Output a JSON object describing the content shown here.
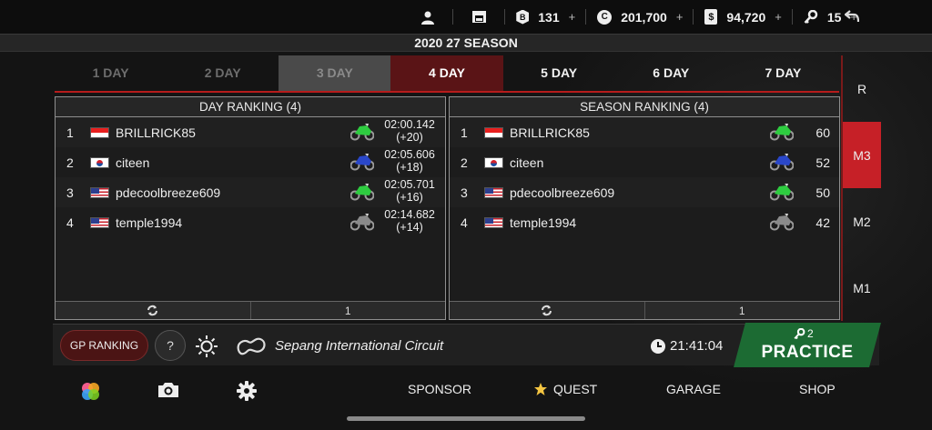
{
  "topbar": {
    "profile_icon": "person-icon",
    "garage_icon": "garage-icon",
    "b_points": {
      "icon": "b-badge-icon",
      "value": "131"
    },
    "coins": {
      "icon": "c-coin-icon",
      "value": "201,700"
    },
    "cash": {
      "icon": "dollar-icon",
      "value": "94,720"
    },
    "keys": {
      "icon": "key-icon",
      "value": "15"
    },
    "plus": "+",
    "back_icon": "back-arrow-icon"
  },
  "season": {
    "title": "2020 27 SEASON"
  },
  "day_tabs": [
    "1 DAY",
    "2 DAY",
    "3 DAY",
    "4 DAY",
    "5 DAY",
    "6 DAY",
    "7 DAY"
  ],
  "active_day": "4 DAY",
  "day_ranking": {
    "title": "DAY RANKING (4)",
    "rows": [
      {
        "pos": "1",
        "flag": "ID",
        "name": "BRILLRICK85",
        "bike": "green",
        "time": "02:00.142",
        "diff": "(+20)"
      },
      {
        "pos": "2",
        "flag": "KR",
        "name": "citeen",
        "bike": "blue",
        "time": "02:05.606",
        "diff": "(+18)"
      },
      {
        "pos": "3",
        "flag": "US",
        "name": "pdecoolbreeze609",
        "bike": "green",
        "time": "02:05.701",
        "diff": "(+16)"
      },
      {
        "pos": "4",
        "flag": "US",
        "name": "temple1994",
        "bike": "gray",
        "time": "02:14.682",
        "diff": "(+14)"
      }
    ],
    "page": "1"
  },
  "season_ranking": {
    "title": "SEASON RANKING (4)",
    "rows": [
      {
        "pos": "1",
        "flag": "ID",
        "name": "BRILLRICK85",
        "bike": "green",
        "points": "60"
      },
      {
        "pos": "2",
        "flag": "KR",
        "name": "citeen",
        "bike": "blue",
        "points": "52"
      },
      {
        "pos": "3",
        "flag": "US",
        "name": "pdecoolbreeze609",
        "bike": "green",
        "points": "50"
      },
      {
        "pos": "4",
        "flag": "US",
        "name": "temple1994",
        "bike": "gray",
        "points": "42"
      }
    ],
    "page": "1"
  },
  "leagues": [
    "R",
    "M3",
    "M2",
    "M1"
  ],
  "active_league": "M3",
  "infobar": {
    "gp_ranking": "GP RANKING",
    "help": "?",
    "track": "Sepang International Circuit",
    "time": "21:41:04"
  },
  "practice": {
    "keys": "2",
    "label": "PRACTICE"
  },
  "bottom_nav": {
    "sponsor": "SPONSOR",
    "quest": "QUEST",
    "garage": "GARAGE",
    "shop": "SHOP"
  },
  "colors": {
    "accent_red": "#c62027",
    "practice_green": "#1c6b33",
    "bike_green": "#2ecc40",
    "bike_blue": "#2a47c9",
    "bike_gray": "#8a8a8a"
  }
}
